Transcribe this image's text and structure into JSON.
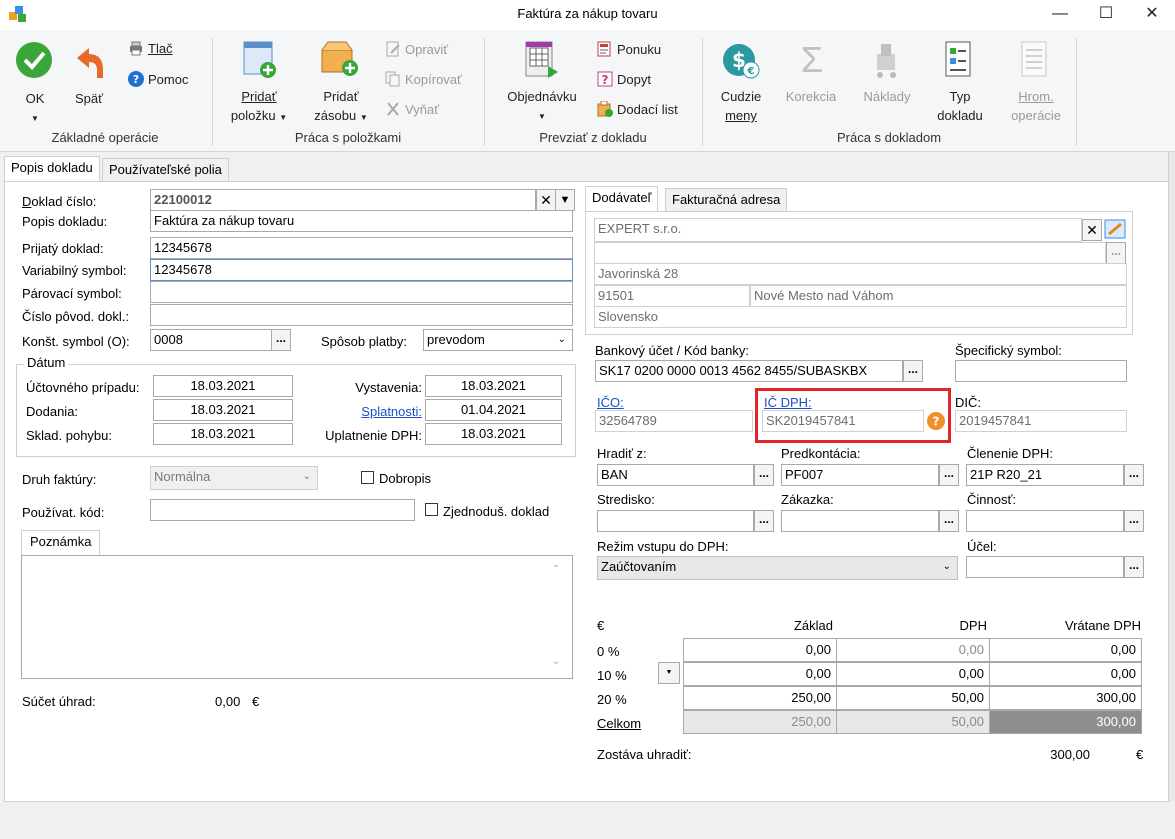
{
  "window": {
    "title": "Faktúra za nákup tovaru"
  },
  "ribbon": {
    "basic": {
      "ok": "OK",
      "back": "Späť",
      "print": "Tlač",
      "help": "Pomoc",
      "group": "Základné operácie"
    },
    "items": {
      "add_item_1": "Pridať",
      "add_item_2": "položku",
      "add_stock_1": "Pridať",
      "add_stock_2": "zásobu",
      "edit": "Opraviť",
      "copy": "Kopírovať",
      "cut": "Vyňať",
      "group": "Práca s položkami"
    },
    "take": {
      "order": "Objednávku",
      "offer": "Ponuku",
      "inquiry": "Dopyt",
      "delivery": "Dodací list",
      "group": "Prevziať z dokladu"
    },
    "doc": {
      "currency_1": "Cudzie",
      "currency_2": "meny",
      "correction": "Korekcia",
      "costs": "Náklady",
      "doctype_1": "Typ",
      "doctype_2": "dokladu",
      "bulk_1": "Hrom.",
      "bulk_2": "operácie",
      "group": "Práca s dokladom"
    }
  },
  "tabs": {
    "description": "Popis dokladu",
    "user_fields": "Používateľské polia"
  },
  "left": {
    "doc_no_label": "Doklad číslo:",
    "doc_no": "22100012",
    "desc_label": "Popis dokladu:",
    "desc": "Faktúra za nákup tovaru",
    "received_label": "Prijatý doklad:",
    "received": "12345678",
    "varsym_label": "Variabilný symbol:",
    "varsym": "12345678",
    "pairsym_label": "Párovací symbol:",
    "pairsym": "",
    "origno_label": "Číslo pôvod. dokl.:",
    "origno": "",
    "constsym_label": "Konšt. symbol (O):",
    "constsym": "0008",
    "payment_label": "Spôsob platby:",
    "payment": "prevodom",
    "dates": {
      "title": "Dátum",
      "accounting_label": "Účtovného prípadu:",
      "accounting": "18.03.2021",
      "delivery_label": "Dodania:",
      "delivery": "18.03.2021",
      "stock_label": "Sklad. pohybu:",
      "stock": "18.03.2021",
      "issue_label": "Vystavenia:",
      "issue": "18.03.2021",
      "due_label": "Splatnosti:",
      "due": "01.04.2021",
      "vat_label": "Uplatnenie DPH:",
      "vat": "18.03.2021"
    },
    "invoice_type_label": "Druh faktúry:",
    "invoice_type": "Normálna",
    "credit_note": "Dobropis",
    "user_code_label": "Používat. kód:",
    "user_code": "",
    "simplified": "Zjednoduš. doklad",
    "note_tab": "Poznámka",
    "sum_label": "Súčet úhrad:",
    "sum_value": "0,00",
    "sum_currency": "€"
  },
  "supplier": {
    "tab_supplier": "Dodávateľ",
    "tab_billing": "Fakturačná adresa",
    "name": "EXPERT s.r.o.",
    "street": "Javorinská 28",
    "zip": "91501",
    "city": "Nové Mesto nad Váhom",
    "country": "Slovensko"
  },
  "right": {
    "bank_label": "Bankový účet / Kód banky:",
    "bank": "SK17 0200 0000 0013 4562 8455/SUBASKBX",
    "specsym_label": "Špecifický symbol:",
    "specsym": "",
    "ico_label": "IČO:",
    "ico": "32564789",
    "icdph_label": "IČ DPH:",
    "icdph": "SK2019457841",
    "dic_label": "DIČ:",
    "dic": "2019457841",
    "pay_from_label": "Hradiť z:",
    "pay_from": "BAN",
    "precont_label": "Predkontácia:",
    "precont": "PF007",
    "vatsplit_label": "Členenie DPH:",
    "vatsplit": "21P R20_21",
    "center_label": "Stredisko:",
    "center": "",
    "contract_label": "Zákazka:",
    "contract": "",
    "activity_label": "Činnosť:",
    "activity": "",
    "vatmode_label": "Režim vstupu do DPH:",
    "vatmode": "Zaúčtovaním",
    "purpose_label": "Účel:",
    "purpose": ""
  },
  "vat": {
    "currency": "€",
    "col_base": "Základ",
    "col_vat": "DPH",
    "col_total": "Vrátane DPH",
    "rows": [
      {
        "label": "0 %",
        "base": "0,00",
        "vat": "0,00",
        "total": "0,00"
      },
      {
        "label": "10 %",
        "base": "0,00",
        "vat": "0,00",
        "total": "0,00"
      },
      {
        "label": "20 %",
        "base": "250,00",
        "vat": "50,00",
        "total": "300,00"
      }
    ],
    "total_label": "Celkom",
    "total_base": "250,00",
    "total_vat": "50,00",
    "total_total": "300,00",
    "remaining_label": "Zostáva uhradiť:",
    "remaining": "300,00",
    "remaining_currency": "€"
  },
  "colors": {
    "highlight": "#e0242a",
    "link": "#1a50c8",
    "ok_green": "#3aa63a"
  }
}
